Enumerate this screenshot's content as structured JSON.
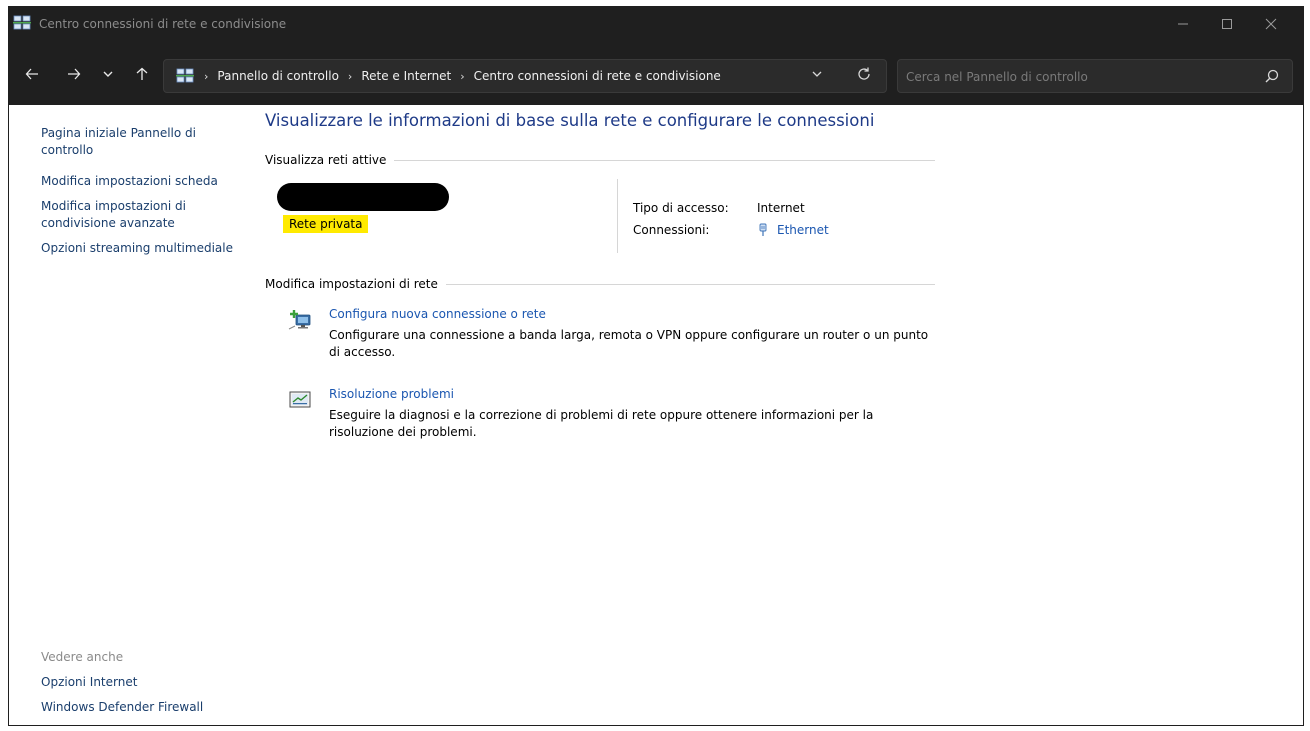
{
  "window": {
    "title": "Centro connessioni di rete e condivisione",
    "app_icon": "network-center-icon"
  },
  "nav": {
    "back_icon": "back-arrow-icon",
    "forward_icon": "forward-arrow-icon",
    "recent_icon": "chevron-down-icon",
    "up_icon": "up-arrow-icon"
  },
  "address": {
    "crumbs": [
      "Pannello di controllo",
      "Rete e Internet",
      "Centro connessioni di rete e condivisione"
    ]
  },
  "search": {
    "placeholder": "Cerca nel Pannello di controllo"
  },
  "sidebar": {
    "items": [
      "Pagina iniziale Pannello di controllo",
      "Modifica impostazioni scheda",
      "Modifica impostazioni di condivisione avanzate",
      "Opzioni streaming multimediale"
    ],
    "see_also_header": "Vedere anche",
    "see_also": [
      "Opzioni Internet",
      "Windows Defender Firewall"
    ]
  },
  "main": {
    "title": "Visualizzare le informazioni di base sulla rete e configurare le connessioni",
    "active_networks_header": "Visualizza reti attive",
    "network": {
      "category": "Rete privata",
      "access_type_label": "Tipo di accesso:",
      "access_type_value": "Internet",
      "connections_label": "Connessioni:",
      "connections_value": "Ethernet"
    },
    "change_settings_header": "Modifica impostazioni di rete",
    "tasks": [
      {
        "label": "Configura nuova connessione o rete",
        "description": "Configurare una connessione a banda larga, remota o VPN oppure configurare un router o un punto di accesso.",
        "icon": "new-connection-icon"
      },
      {
        "label": "Risoluzione problemi",
        "description": "Eseguire la diagnosi e la correzione di problemi di rete oppure ottenere informazioni per la risoluzione dei problemi.",
        "icon": "troubleshoot-icon"
      }
    ]
  },
  "colors": {
    "titlebar_bg": "#1f1f1f",
    "link": "#1a56b0",
    "title": "#1e3a87",
    "highlight": "#ffea00"
  }
}
